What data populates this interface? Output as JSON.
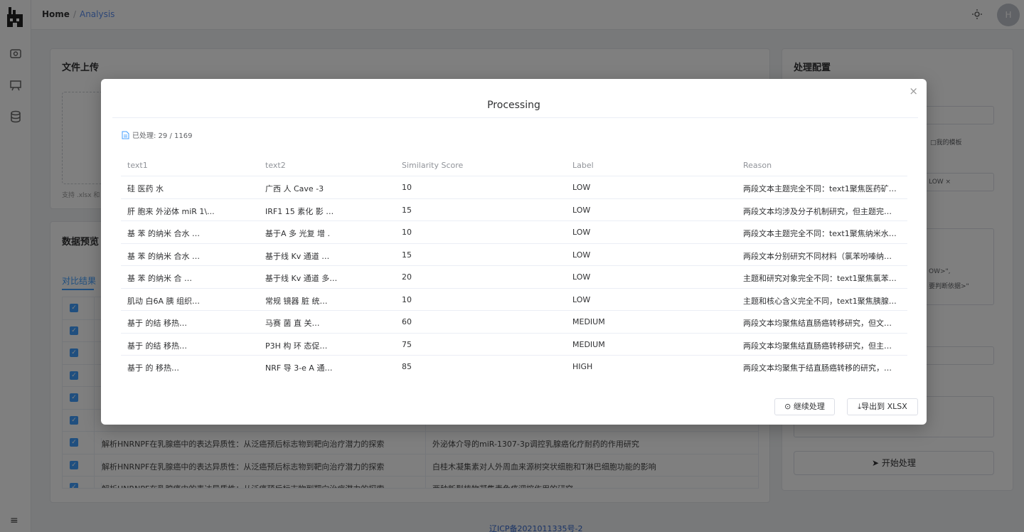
{
  "breadcrumb": {
    "home": "Home",
    "current": "Analysis"
  },
  "avatar": {
    "initial": "H"
  },
  "upload_card": {
    "title": "文件上传",
    "hint": "支持 .xlsx 和"
  },
  "preview_card": {
    "title": "数据预览",
    "tab": "对比结果"
  },
  "preview_rows": [
    {
      "text1": "",
      "text2": ""
    },
    {
      "text1": "",
      "text2": ""
    },
    {
      "text1": "",
      "text2": ""
    },
    {
      "text1": "",
      "text2": ""
    },
    {
      "text1": "",
      "text2": ""
    },
    {
      "text1": "",
      "text2": ""
    },
    {
      "text1": "解析HNRNPF在乳腺癌中的表达异质性：从泛癌预后标志物到靶向治疗潜力的探索",
      "text2": "外泌体介导的miR-1307-3p调控乳腺癌化疗耐药的作用研究"
    },
    {
      "text1": "解析HNRNPF在乳腺癌中的表达异质性：从泛癌预后标志物到靶向治疗潜力的探索",
      "text2": "白桂木凝集素对人外周血来源树突状细胞和T淋巴细胞功能的影响"
    },
    {
      "text1": "解析HNRNPF在乳腺癌中的表达异质性：从泛癌预后标志物到靶向治疗潜力的探索",
      "text2": "两种新型植物凝集素免疫调控作用的研究"
    }
  ],
  "config_card": {
    "title": "处理配置",
    "template_button": "□我的模板",
    "tag": "LOW ×",
    "prompt_snippet_1": "OW>\",",
    "prompt_snippet_2": "要判断依据>\"",
    "start_button": "开始处理"
  },
  "footer": {
    "icp": "辽ICP备2021011335号-2"
  },
  "modal": {
    "title": "Processing",
    "close": "×",
    "progress": "已处理: 29 / 1169",
    "columns": {
      "text1": "text1",
      "text2": "text2",
      "score": "Similarity Score",
      "label": "Label",
      "reason": "Reason"
    },
    "rows": [
      {
        "text1": "硅 医药 水",
        "text2": "广西 人 Cave -3",
        "score": "10",
        "label": "LOW",
        "reason": "两段文本主题完全不同：text1聚焦医药矿…"
      },
      {
        "text1": "肝 胞来 外泌体 miR 1\\...",
        "text2": "IRF1 15 素化 影 …",
        "score": "15",
        "label": "LOW",
        "reason": "两段文本均涉及分子机制研究，但主题完…"
      },
      {
        "text1": "基 苯 的纳米 合水 …",
        "text2": "基于A 多 光复 增 .",
        "score": "10",
        "label": "LOW",
        "reason": "两段文本主题完全不同：text1聚焦纳米水…"
      },
      {
        "text1": "基 苯 的纳米 合水 …",
        "text2": "基于线 Kv 通道 …",
        "score": "15",
        "label": "LOW",
        "reason": "两段文本分别研究不同材料（氯苯吩嗪纳…"
      },
      {
        "text1": "基 苯 的纳米 合 …",
        "text2": "基于线 Kv 通道 多…",
        "score": "20",
        "label": "LOW",
        "reason": "主题和研究对象完全不同：text1聚焦氯苯…"
      },
      {
        "text1": "肌动 白6A 胰 组织…",
        "text2": "常规 镜器 脏 统…",
        "score": "10",
        "label": "LOW",
        "reason": "主题和核心含义完全不同，text1聚焦胰腺…"
      },
      {
        "text1": "基于 的结 移热…",
        "text2": "马赛 菌 直 关…",
        "score": "60",
        "label": "MEDIUM",
        "reason": "两段文本均聚焦结直肠癌转移研究，但文…"
      },
      {
        "text1": "基于 的结 移热…",
        "text2": "P3H 构 环 态促…",
        "score": "75",
        "label": "MEDIUM",
        "reason": "两段文本均聚焦结直肠癌转移研究，但主…"
      },
      {
        "text1": "基于 的 移热…",
        "text2": "NRF 导 3-e A 通…",
        "score": "85",
        "label": "HIGH",
        "reason": "两段文本均聚焦于结直肠癌转移的研究，…"
      }
    ],
    "continue_button": "继续处理",
    "export_button": "导出到 XLSX"
  }
}
